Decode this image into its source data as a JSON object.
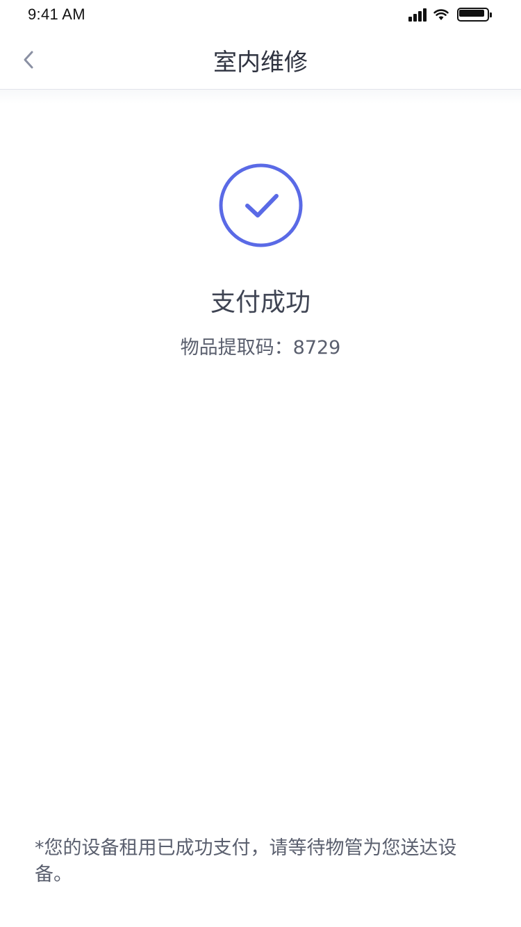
{
  "status_bar": {
    "time": "9:41 AM",
    "icons": [
      "signal-icon",
      "wifi-icon",
      "battery-icon"
    ]
  },
  "nav": {
    "title": "室内维修",
    "back_icon": "chevron-left-icon"
  },
  "result": {
    "icon": "check-circle-icon",
    "title": "支付成功",
    "pickup_label": "物品提取码：",
    "pickup_code": "8729"
  },
  "footnote": "*您的设备租用已成功支付，请等待物管为您送达设备。",
  "colors": {
    "accent": "#5a6ae6",
    "text_primary": "#2f3340",
    "text_secondary": "#5a5f6e",
    "divider": "#e1e3ea"
  }
}
